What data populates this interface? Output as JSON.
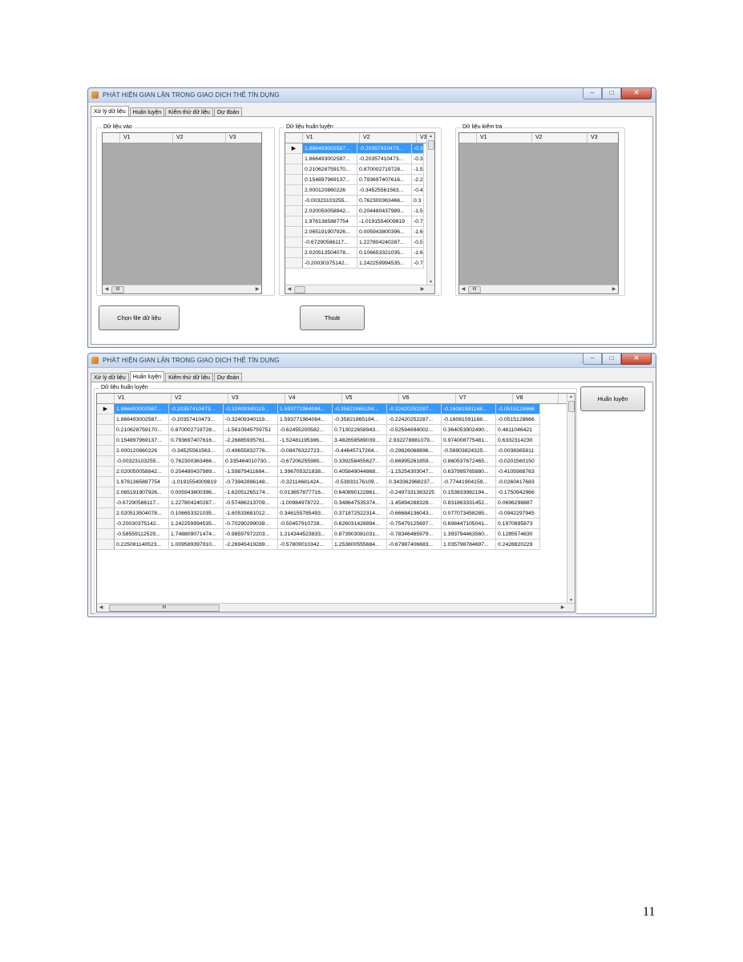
{
  "window_title": "PHÁT HIỆN GIAN LẬN TRONG GIAO DỊCH THẺ TÍN DỤNG",
  "window_controls": {
    "minimize": "–",
    "maximize": "□",
    "close": "✕"
  },
  "tabs": [
    "Xử lý dữ liệu",
    "Huấn luyện",
    "Kiểm thử dữ liệu",
    "Dự đoán"
  ],
  "screen1": {
    "active_tab": "Xử lý dữ liệu",
    "group_input": "Dữ liệu vào",
    "group_train": "Dữ liệu huấn luyện",
    "group_test": "Dữ liệu kiểm tra",
    "input_columns": [
      "V1",
      "V2",
      "V3"
    ],
    "train_columns": [
      "V1",
      "V2",
      "V3"
    ],
    "test_columns": [
      "V1",
      "V2",
      "V3"
    ],
    "train_rows": [
      [
        "1.866493002587...",
        "-0.20357410473...",
        "-0.3"
      ],
      [
        "1.866493002587...",
        "-0.20357410473...",
        "-0.3"
      ],
      [
        "0.210628759170...",
        "0.870002719728...",
        "-1.5"
      ],
      [
        "0.154897969137...",
        "0.793697407616...",
        "-2.2"
      ],
      [
        "2.000120860226",
        "-0.34525561563...",
        "-0.4"
      ],
      [
        "-0.00323103255...",
        "0.762300363466...",
        "0.3"
      ],
      [
        "2.020050058842...",
        "0.204480437989...",
        "-1.5"
      ],
      [
        "1.9761365887754",
        "-1.0191554009819",
        "-0.7"
      ],
      [
        "2.065191907926...",
        "0.005943800396...",
        "-1.6"
      ],
      [
        "-0.67290586117...",
        "1.227804240287...",
        "-0.5"
      ],
      [
        "2.020513504078...",
        "0.106653321035...",
        "-1.6"
      ],
      [
        "-0.20030375142...",
        "1.242259994535...",
        "-0.7"
      ]
    ],
    "choose_file_button": "Chọn file dữ liệu",
    "exit_button": "Thoát",
    "scroll_glyph": "III"
  },
  "screen2": {
    "active_tab": "Huấn luyện",
    "group_train": "Dữ liệu huấn luyện",
    "columns": [
      "V1",
      "V2",
      "V3",
      "V4",
      "V5",
      "V6",
      "V7",
      "V8"
    ],
    "rows": [
      [
        "1.866493002587...",
        "-0.20357410473...",
        "-0.32409340119...",
        "1.593771964084...",
        "-0.35821865194...",
        "-0.22420252287...",
        "-0.16081591168...",
        "-0.0515128666"
      ],
      [
        "1.866493002587...",
        "-0.20357410473...",
        "-0.32409340119...",
        "1.593771964084...",
        "-0.35821865194...",
        "-0.22420252287...",
        "-0.16081591168...",
        "-0.0515128666"
      ],
      [
        "0.210628759170...",
        "0.870002719728...",
        "-1.5610945759751",
        "-0.62455200582...",
        "0.713022658943...",
        "-0.52594694002...",
        "0.364053902490...",
        "0.4611046421"
      ],
      [
        "0.154897969137...",
        "0.793697407616...",
        "-2.26885935761...",
        "-1.52481195386...",
        "3.482658589039...",
        "2.932278881079...",
        "0.974008775481...",
        "0.6332314230"
      ],
      [
        "2.000120860226",
        "-0.34525561563...",
        "-0.49655832776...",
        "-0.08476322723...",
        "-0.44645717264...",
        "-0.29826068896...",
        "-0.56903824325...",
        "-0.0038365811"
      ],
      [
        "-0.00323103255...",
        "0.762300363466...",
        "0.335464010730...",
        "-0.67206255985...",
        "0.339258455627...",
        "-0.86995261859...",
        "0.860537672465...",
        "-0.0201560150"
      ],
      [
        "2.020050058842...",
        "0.204480437989...",
        "-1.59879411684...",
        "1.396705321838...",
        "0.405849044868...",
        "-1.15254303047...",
        "0.637995765880...",
        "-0.4105988763"
      ],
      [
        "1.9761365887754",
        "-1.0191554009819",
        "-0.73942896148...",
        "-0.32114681424...",
        "-0.53933176109...",
        "0.343362968237...",
        "-0.77441904159...",
        "-0.0260417683"
      ],
      [
        "2.065191907926...",
        "0.005943800396...",
        "-1.62051265174...",
        "0.013657877716...",
        "0.640890122861...",
        "-0.2497331383225",
        "0.153833982194...",
        "-0.1750942966"
      ],
      [
        "-0.67290586117...",
        "1.227804240287...",
        "-0.57486213709...",
        "-1.00984978722...",
        "0.348647535374...",
        "-1.45894288328...",
        "0.831863331452...",
        "0.0696298887"
      ],
      [
        "2.020513504078...",
        "0.106653321035...",
        "-1.60533681012...",
        "0.346155785493...",
        "0.371872522314...",
        "-0.66684136043...",
        "0.077073458285...",
        "-0.0942297945"
      ],
      [
        "-0.20030375142...",
        "1.242259994535...",
        "-0.70290299039...",
        "-0.50457910728...",
        "0.626031428894...",
        "-0.75479125697...",
        "0.698447105041...",
        "0.1970895873"
      ],
      [
        "-0.58559112529...",
        "1.748809071474...",
        "-0.98597972203...",
        "1.214344523833...",
        "0.873903081031...",
        "-0.78346465979...",
        "1.393794463560...",
        "0.1285574630"
      ],
      [
        "0.225081140523...",
        "1.009589397910...",
        "-2.26945419289...",
        "-0.57809010342...",
        "1.253800555684...",
        "-0.67987406683...",
        "1.035798784697...",
        "0.2428820229"
      ]
    ],
    "train_button": "Huấn luyện",
    "scroll_glyph": "III"
  },
  "page_number": "11"
}
